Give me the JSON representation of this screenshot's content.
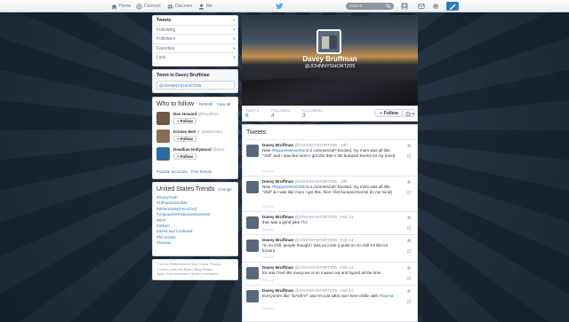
{
  "nav": {
    "home": "Home",
    "connect": "Connect",
    "discover": "Discover",
    "me": "Me",
    "search_placeholder": "Search"
  },
  "sidebar_menu": {
    "items": [
      {
        "label": "Tweets",
        "active": true
      },
      {
        "label": "Following",
        "active": false
      },
      {
        "label": "Followers",
        "active": false
      },
      {
        "label": "Favorites",
        "active": false
      },
      {
        "label": "Lists",
        "active": false
      }
    ]
  },
  "tweet_to": {
    "title": "Tweet to Davey Bruffman",
    "value": "@JOHNNYSHORTZ05"
  },
  "who_to_follow": {
    "title": "Who to follow",
    "refresh": "Refresh",
    "view_all": "View all",
    "follow_label": "Follow",
    "accounts": [
      {
        "name": "Ron Howard",
        "handle": "@RealRon...",
        "color": "#6b5a48"
      },
      {
        "name": "Kristen Bell",
        "handle": "@IMKristen...",
        "color": "#8a6c55"
      },
      {
        "name": "Deadline Hollywood",
        "handle": "@Dea...",
        "color": "#2f6aa3"
      }
    ],
    "popular_accounts": "Popular accounts",
    "find_friends": "Find friends"
  },
  "trends": {
    "title": "United States Trends",
    "change": "Change",
    "items": [
      "#DumpTruth",
      "#10FactsAboutMe",
      "#WhereIsMyGreenCard",
      "#UnpopularRestaurantQuestion",
      "#BTP",
      "Kimbrel",
      "Dazed and Confused",
      "Phil Keyser",
      "Slovenia"
    ]
  },
  "footer": {
    "line1": "© 2014 Twitter About Help Terms Privacy",
    "line2": "Cookies Ads info Brand Blog Status",
    "line3": "Apps Jobs Advertise Media Developers"
  },
  "profile": {
    "name": "Davey Bruffman",
    "handle": "@JOHNNYSHORTZ05",
    "stats": [
      {
        "label": "TWEETS",
        "value": "6"
      },
      {
        "label": "FOLLOWING",
        "value": "4"
      },
      {
        "label": "FOLLOWERS",
        "value": "3"
      }
    ],
    "follow_label": "Follow"
  },
  "timeline": {
    "title": "Tweets",
    "expand_label": "Expand",
    "tweets": [
      {
        "name": "Davey Bruffman",
        "handle": "@JOHNNYSHORTZ05",
        "time": "· 10h",
        "text_before": "New ",
        "tag": "#MuppetsMostWanted",
        "text_after": " commercial? Excited, my mom was all like \"chill\" and I was like mom I got this then I fist bumped Kermit (in my mind)"
      },
      {
        "name": "Davey Bruffman",
        "handle": "@JOHNNYSHORTZ05",
        "time": "· 10h",
        "text_before": "New ",
        "tag": "#MuppetsMostWanted",
        "text_after": " commercial? Excited, my mom was all like \"chill\" & I was like mom I got this, then I fist bumped Kermit (in my mind)"
      },
      {
        "name": "Davey Bruffman",
        "handle": "@JOHNNYSHORTZ05",
        "time": "· Feb 14",
        "text_before": "that was a good joke ",
        "tag": "#lol",
        "text_after": ""
      },
      {
        "name": "Davey Bruffman",
        "handle": "@JOHNNYSHORTZ05",
        "time": "· Feb 14",
        "text_before": "i'm so chill, people thought i was an icicle (cause im so chill it's like im frozen)",
        "tag": "",
        "text_after": ""
      },
      {
        "name": "Davey Bruffman",
        "handle": "@JOHNNYSHORTZ05",
        "time": "· Feb 13",
        "text_before": "for real I feel like everyone is so maxed out and hyped all the time",
        "tag": "",
        "text_after": ""
      },
      {
        "name": "Davey Bruffman",
        "handle": "@JOHNNYSHORTZ05",
        "time": "· Feb 12",
        "text_before": "Everyone's like \"DAVEY!\" and I'm just sittin over here chillin with ",
        "tag": "#lopmid",
        "text_after": ""
      }
    ]
  },
  "colors": {
    "accent": "#2b7bb9",
    "background": "#1d2c3a"
  }
}
